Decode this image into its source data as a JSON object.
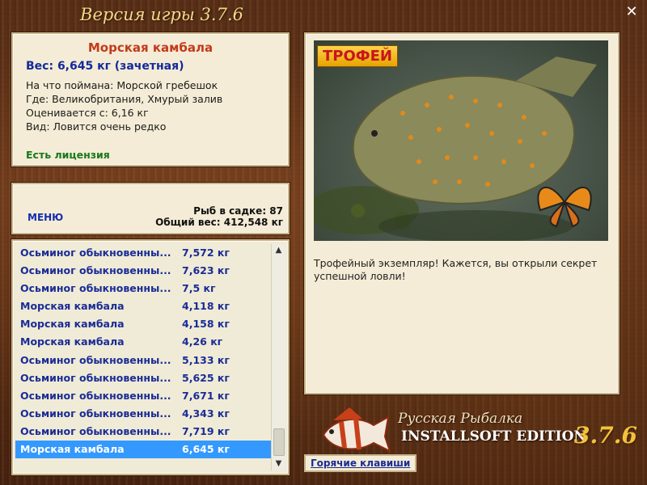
{
  "window": {
    "title": "Версия игры 3.7.6",
    "close_symbol": "✕"
  },
  "catch_info": {
    "fish_name": "Морская камбала",
    "weight": "Вес: 6,645 кг (зачетная)",
    "bait": "На что поймана: Морской гребешок",
    "location": "Где: Великобритания, Хмурый залив",
    "valued_from": "Оценивается с: 6,16 кг",
    "rarity": "Вид: Ловится очень редко",
    "license": "Есть лицензия"
  },
  "summary": {
    "menu_label": "МЕНЮ",
    "fish_in_keepnet": "Рыб в садке: 87",
    "total_weight": "Общий вес: 412,548 кг"
  },
  "catch_list": [
    {
      "name": "Осьминог обыкновенны...",
      "weight": "7,572 кг"
    },
    {
      "name": "Осьминог обыкновенны...",
      "weight": "7,623 кг"
    },
    {
      "name": "Осьминог обыкновенны...",
      "weight": "7,5 кг"
    },
    {
      "name": "Морская камбала",
      "weight": "4,118 кг"
    },
    {
      "name": "Морская камбала",
      "weight": "4,158 кг"
    },
    {
      "name": "Морская камбала",
      "weight": "4,26 кг"
    },
    {
      "name": "Осьминог обыкновенны...",
      "weight": "5,133 кг"
    },
    {
      "name": "Осьминог обыкновенны...",
      "weight": "5,625 кг"
    },
    {
      "name": "Осьминог обыкновенны...",
      "weight": "7,671 кг"
    },
    {
      "name": "Осьминог обыкновенны...",
      "weight": "4,343 кг"
    },
    {
      "name": "Осьминог обыкновенны...",
      "weight": "7,719 кг"
    },
    {
      "name": "Морская камбала",
      "weight": "6,645 кг",
      "selected": true
    }
  ],
  "photo": {
    "badge": "ТРОФЕЙ",
    "description": "Трофейный экземпляр! Кажется, вы открыли секрет успешной ловли!"
  },
  "logo": {
    "title": "Русская Рыбалка",
    "edition": "INSTALLSOFT EDITION",
    "version": "3.7.6"
  },
  "footer": {
    "hotkeys_label": "Горячие клавиши"
  },
  "colors": {
    "selected_row": "#3399ff",
    "fish_name": "#c33a1a",
    "weight_text": "#132a9a",
    "license_text": "#18781c",
    "list_text": "#1a2c96"
  }
}
